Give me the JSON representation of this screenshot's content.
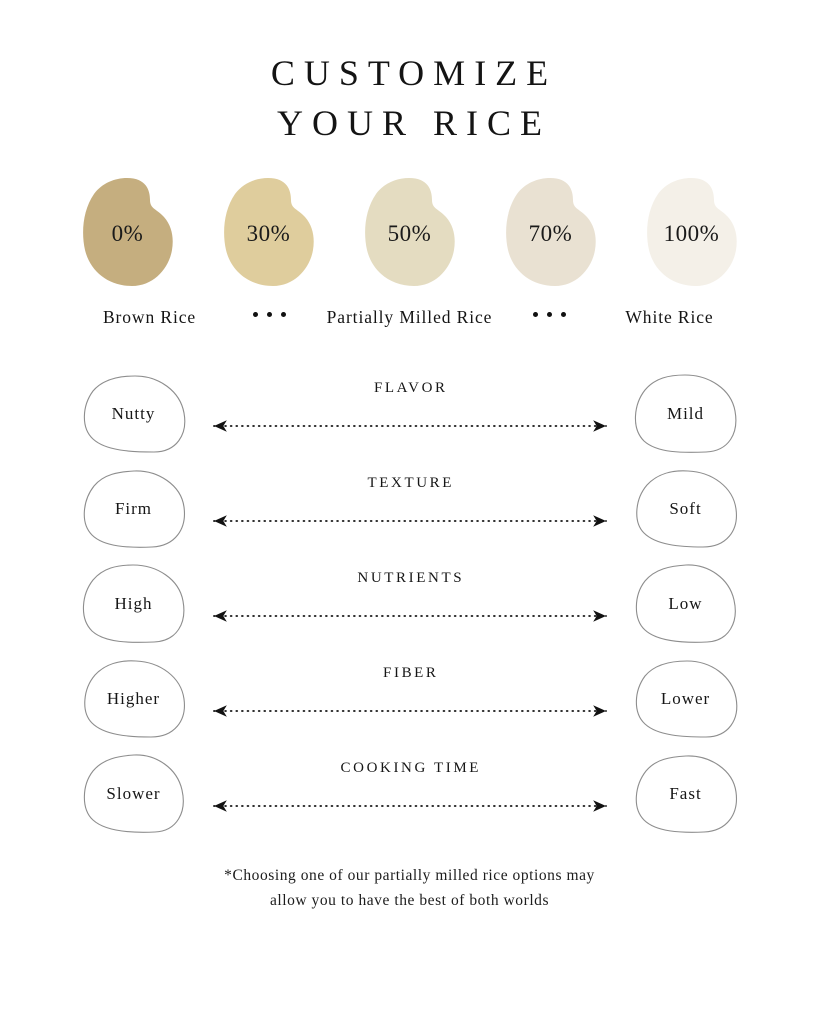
{
  "header": {
    "title_line1": "CUSTOMIZE",
    "title_line2": "YOUR RICE"
  },
  "milling_scale": {
    "swatches": [
      {
        "label": "0%",
        "color": "#c5ae7f"
      },
      {
        "label": "30%",
        "color": "#dfcd9d"
      },
      {
        "label": "50%",
        "color": "#e4dcc1"
      },
      {
        "label": "70%",
        "color": "#e9e1d2"
      },
      {
        "label": "100%",
        "color": "#f4f0e8"
      }
    ],
    "legend": {
      "left": "Brown Rice",
      "middle": "Partially Milled Rice",
      "right": "White Rice",
      "separator_dots": 3
    }
  },
  "comparisons": [
    {
      "title": "FLAVOR",
      "left": "Nutty",
      "right": "Mild"
    },
    {
      "title": "TEXTURE",
      "left": "Firm",
      "right": "Soft"
    },
    {
      "title": "NUTRIENTS",
      "left": "High",
      "right": "Low"
    },
    {
      "title": "FIBER",
      "left": "Higher",
      "right": "Lower"
    },
    {
      "title": "COOKING TIME",
      "left": "Slower",
      "right": "Fast"
    }
  ],
  "footnote": {
    "text": "*Choosing one of our partially milled rice options may allow you to have the best of both worlds"
  },
  "colors": {
    "background": "#ffffff",
    "text": "#161616",
    "outline": "#8d8d8d",
    "arrow": "#111111"
  }
}
